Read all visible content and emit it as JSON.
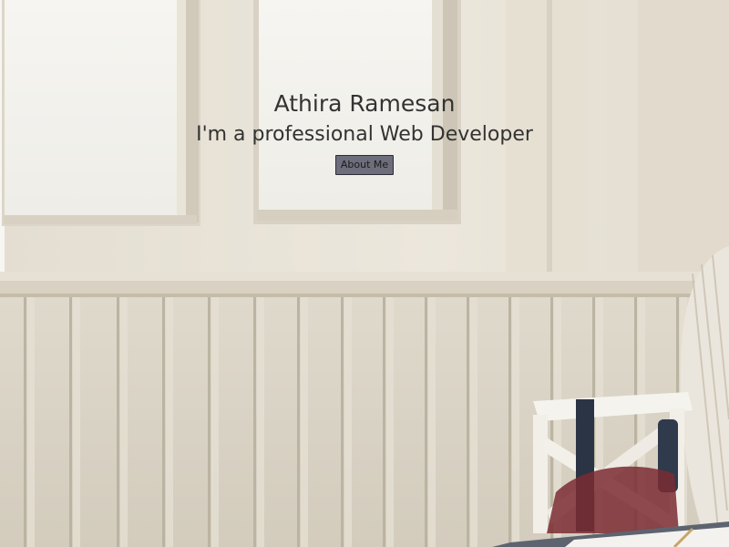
{
  "hero": {
    "name": "Athira Ramesan",
    "tagline": "I'm a professional Web Developer",
    "about_button_label": "About Me"
  },
  "background": {
    "scene": "photo-interior-windows-wainscoting-chair",
    "colors": {
      "wall": "#ebe6da",
      "window_glass": "#f4f3ef",
      "panel": "#ddd7ca",
      "panel_shadow": "#b8b09f",
      "chair": "#f5f3ee",
      "strap": "#2b3444",
      "table": "#5d6470"
    }
  },
  "colors": {
    "text": "#333333",
    "button_bg": "#6e6d7c",
    "button_border": "#2d2d36"
  }
}
